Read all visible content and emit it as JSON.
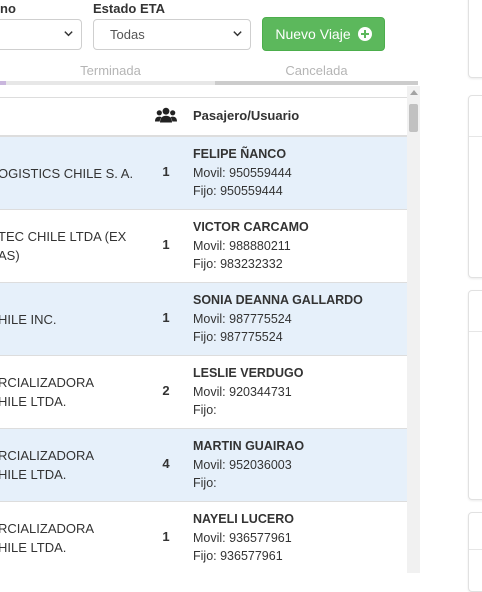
{
  "filters": {
    "first": {
      "label": "no",
      "value": ""
    },
    "estado_eta": {
      "label": "Estado ETA",
      "value": "Todas"
    }
  },
  "new_trip_button": {
    "label": "Nuevo Viaje",
    "icon": "plus-circle-icon"
  },
  "tabs": [
    {
      "label": "Terminada"
    },
    {
      "label": "Cancelada"
    }
  ],
  "table": {
    "headers": {
      "count_icon": "users-icon",
      "passenger": "Pasajero/Usuario"
    },
    "rows": [
      {
        "company": "OGISTICS CHILE S. A.",
        "count": "1",
        "name": "FELIPE ÑANCO",
        "movil": "Movil: 950559444",
        "fijo": "Fijo: 950559444"
      },
      {
        "company": "TEC CHILE LTDA (EX\nAS)",
        "count": "1",
        "name": "VICTOR CARCAMO",
        "movil": "Movil: 988880211",
        "fijo": "Fijo: 983232332"
      },
      {
        "company": "HILE INC.",
        "count": "1",
        "name": "SONIA DEANNA GALLARDO",
        "movil": "Movil: 987775524",
        "fijo": "Fijo: 987775524"
      },
      {
        "company": "RCIALIZADORA\nHILE LTDA.",
        "count": "2",
        "name": "LESLIE VERDUGO",
        "movil": "Movil: 920344731",
        "fijo": "Fijo:"
      },
      {
        "company": "RCIALIZADORA\nHILE LTDA.",
        "count": "4",
        "name": "MARTIN GUAIRAO",
        "movil": "Movil: 952036003",
        "fijo": "Fijo:"
      },
      {
        "company": "RCIALIZADORA\nHILE LTDA.",
        "count": "1",
        "name": "NAYELI LUCERO",
        "movil": "Movil: 936577961",
        "fijo": "Fijo: 936577961"
      }
    ]
  },
  "colors": {
    "primary_button": "#5cb85c",
    "tab_active": "#c9b6dd",
    "tab_inactive": "#cccccc",
    "row_highlight": "#e6f0fa"
  }
}
